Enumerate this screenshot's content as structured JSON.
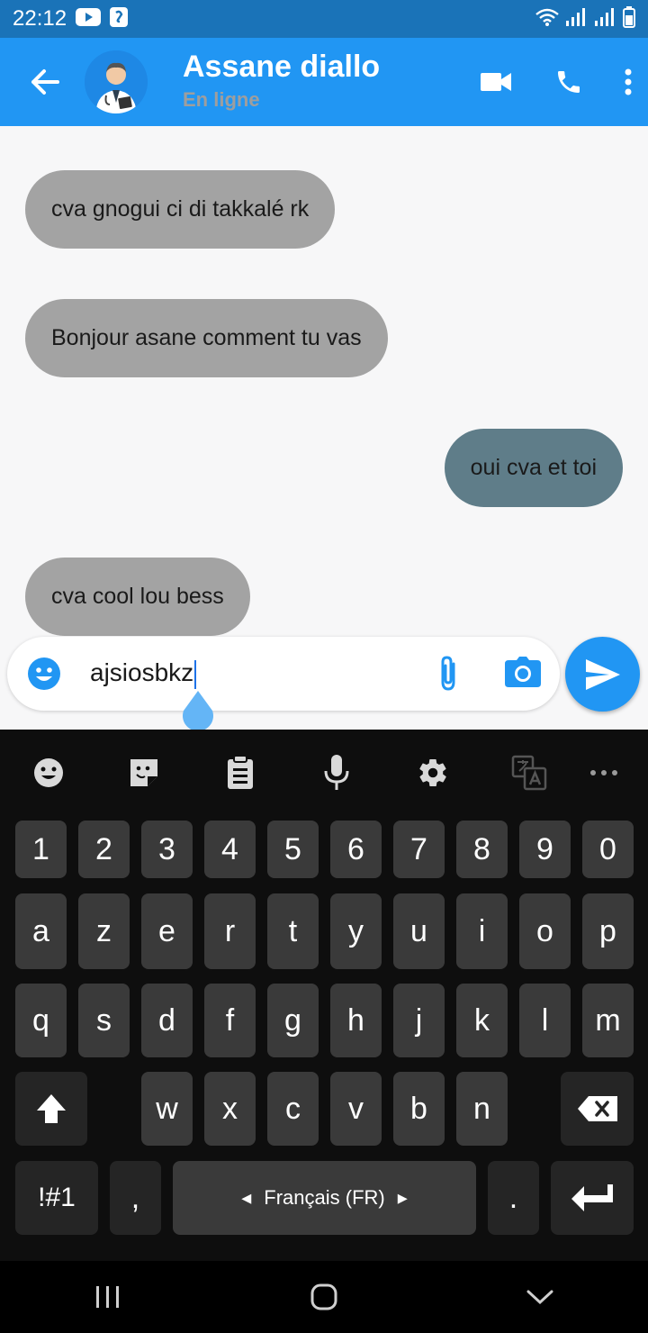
{
  "status_bar": {
    "time": "22:12",
    "bg_color": "#1a73b8"
  },
  "header": {
    "contact_name": "Assane diallo",
    "status": "En ligne",
    "bg_color": "#2196f3",
    "icons": [
      "back-arrow-icon",
      "avatar-doctor",
      "video-call-icon",
      "phone-icon",
      "more-vert-icon"
    ]
  },
  "messages": [
    {
      "text": "cva gnogui ci di takkalé rk",
      "direction": "incoming"
    },
    {
      "text": "Bonjour asane comment tu vas",
      "direction": "incoming"
    },
    {
      "text": "oui cva et toi",
      "direction": "outgoing"
    },
    {
      "text": "cva cool lou bess",
      "direction": "incoming"
    }
  ],
  "composer": {
    "value": "ajsiosbkz",
    "icons": [
      "emoji-icon",
      "attach-icon",
      "camera-icon",
      "send-icon"
    ]
  },
  "keyboard": {
    "toolbar_icons": [
      "emoji-icon",
      "sticker-icon",
      "clipboard-icon",
      "microphone-icon",
      "settings-icon",
      "translate-icon",
      "more-horiz-icon"
    ],
    "row_numbers": [
      "1",
      "2",
      "3",
      "4",
      "5",
      "6",
      "7",
      "8",
      "9",
      "0"
    ],
    "row_1": [
      "a",
      "z",
      "e",
      "r",
      "t",
      "y",
      "u",
      "i",
      "o",
      "p"
    ],
    "row_2": [
      "q",
      "s",
      "d",
      "f",
      "g",
      "h",
      "j",
      "k",
      "l",
      "m"
    ],
    "row_3": [
      "w",
      "x",
      "c",
      "v",
      "b",
      "n"
    ],
    "symbols_label": "!#1",
    "comma_label": ",",
    "space_label": "Français (FR)",
    "period_label": "."
  },
  "colors": {
    "incoming_bubble": "#a3a3a3",
    "outgoing_bubble": "#5f7d89",
    "chat_bg": "#f7f7f8",
    "accent": "#2196f3"
  }
}
